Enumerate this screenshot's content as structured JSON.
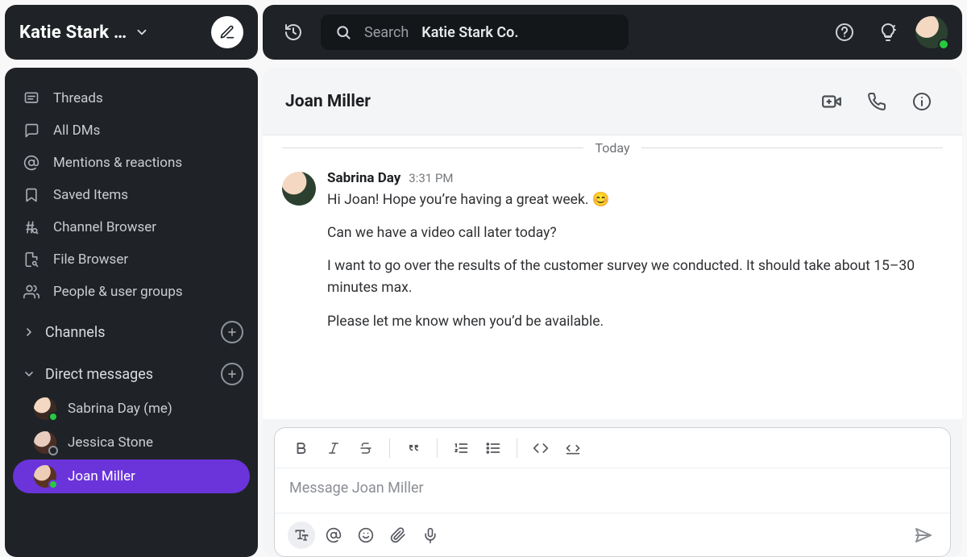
{
  "workspace": {
    "name": "Katie Stark …"
  },
  "search": {
    "label": "Search",
    "scope": "Katie Stark Co."
  },
  "nav": {
    "items": [
      {
        "key": "threads",
        "label": "Threads"
      },
      {
        "key": "alldms",
        "label": "All DMs"
      },
      {
        "key": "mentions",
        "label": "Mentions & reactions"
      },
      {
        "key": "saved",
        "label": "Saved Items"
      },
      {
        "key": "chbrowse",
        "label": "Channel Browser"
      },
      {
        "key": "fbrowse",
        "label": "File Browser"
      },
      {
        "key": "people",
        "label": "People & user groups"
      }
    ]
  },
  "sections": {
    "channels": {
      "label": "Channels"
    },
    "dms": {
      "label": "Direct messages"
    }
  },
  "dms": [
    {
      "name": "Sabrina Day (me)",
      "presence": "online",
      "active": false
    },
    {
      "name": "Jessica Stone",
      "presence": "offline",
      "active": false
    },
    {
      "name": "Joan Miller",
      "presence": "online",
      "active": true
    }
  ],
  "conversation": {
    "title": "Joan Miller",
    "date_label": "Today",
    "messages": [
      {
        "author": "Sabrina Day",
        "time": "3:31 PM",
        "lines": [
          "Hi Joan! Hope you’re having a great week. 😊",
          "Can we have a video call later today?",
          "I want to go over the results of the customer survey we conducted. It should take about 15–30 minutes max.",
          "Please let me know when you’d be available."
        ]
      }
    ]
  },
  "composer": {
    "placeholder": "Message Joan Miller"
  }
}
